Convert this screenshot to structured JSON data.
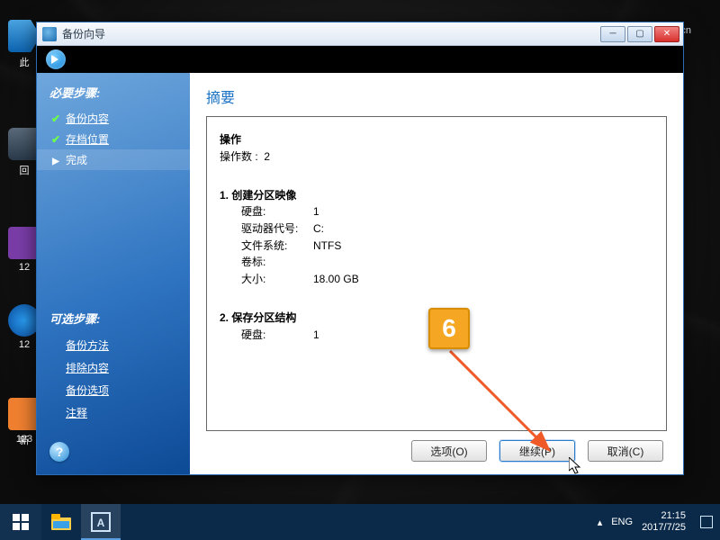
{
  "window": {
    "title": "备份向导",
    "minimize_tooltip": "最小化",
    "maximize_tooltip": "最大化",
    "close_tooltip": "关闭"
  },
  "sidebar": {
    "required_header": "必要步骤:",
    "steps": [
      {
        "label": "备份内容",
        "state": "done"
      },
      {
        "label": "存档位置",
        "state": "done"
      },
      {
        "label": "完成",
        "state": "current"
      }
    ],
    "optional_header": "可选步骤:",
    "optional_steps": [
      {
        "label": "备份方法"
      },
      {
        "label": "排除内容"
      },
      {
        "label": "备份选项"
      },
      {
        "label": "注释"
      }
    ],
    "help_tooltip": "帮助"
  },
  "main": {
    "heading": "摘要",
    "summary": {
      "section_action": "操作",
      "action_count_label": "操作数 :",
      "action_count_value": "2",
      "op1_title": "1.  创建分区映像",
      "op1": {
        "disk_label": "硬盘:",
        "disk_value": "1",
        "drive_label": "驱动器代号:",
        "drive_value": "C:",
        "fs_label": "文件系统:",
        "fs_value": "NTFS",
        "vol_label": "卷标:",
        "vol_value": "",
        "size_label": "大小:",
        "size_value": "18.00 GB"
      },
      "op2_title": "2.  保存分区结构",
      "op2": {
        "disk_label": "硬盘:",
        "disk_value": "1"
      }
    },
    "buttons": {
      "options": "选项(O)",
      "proceed": "继续(P)",
      "cancel": "取消(C)"
    }
  },
  "annotation": {
    "number": "6"
  },
  "taskbar": {
    "lang": "ENG",
    "time": "21:15",
    "date": "2017/7/25"
  },
  "desktop": {
    "top_right_badge": "cn",
    "icon_labels": [
      "此",
      "回",
      "12",
      "12",
      "新",
      "123"
    ]
  }
}
